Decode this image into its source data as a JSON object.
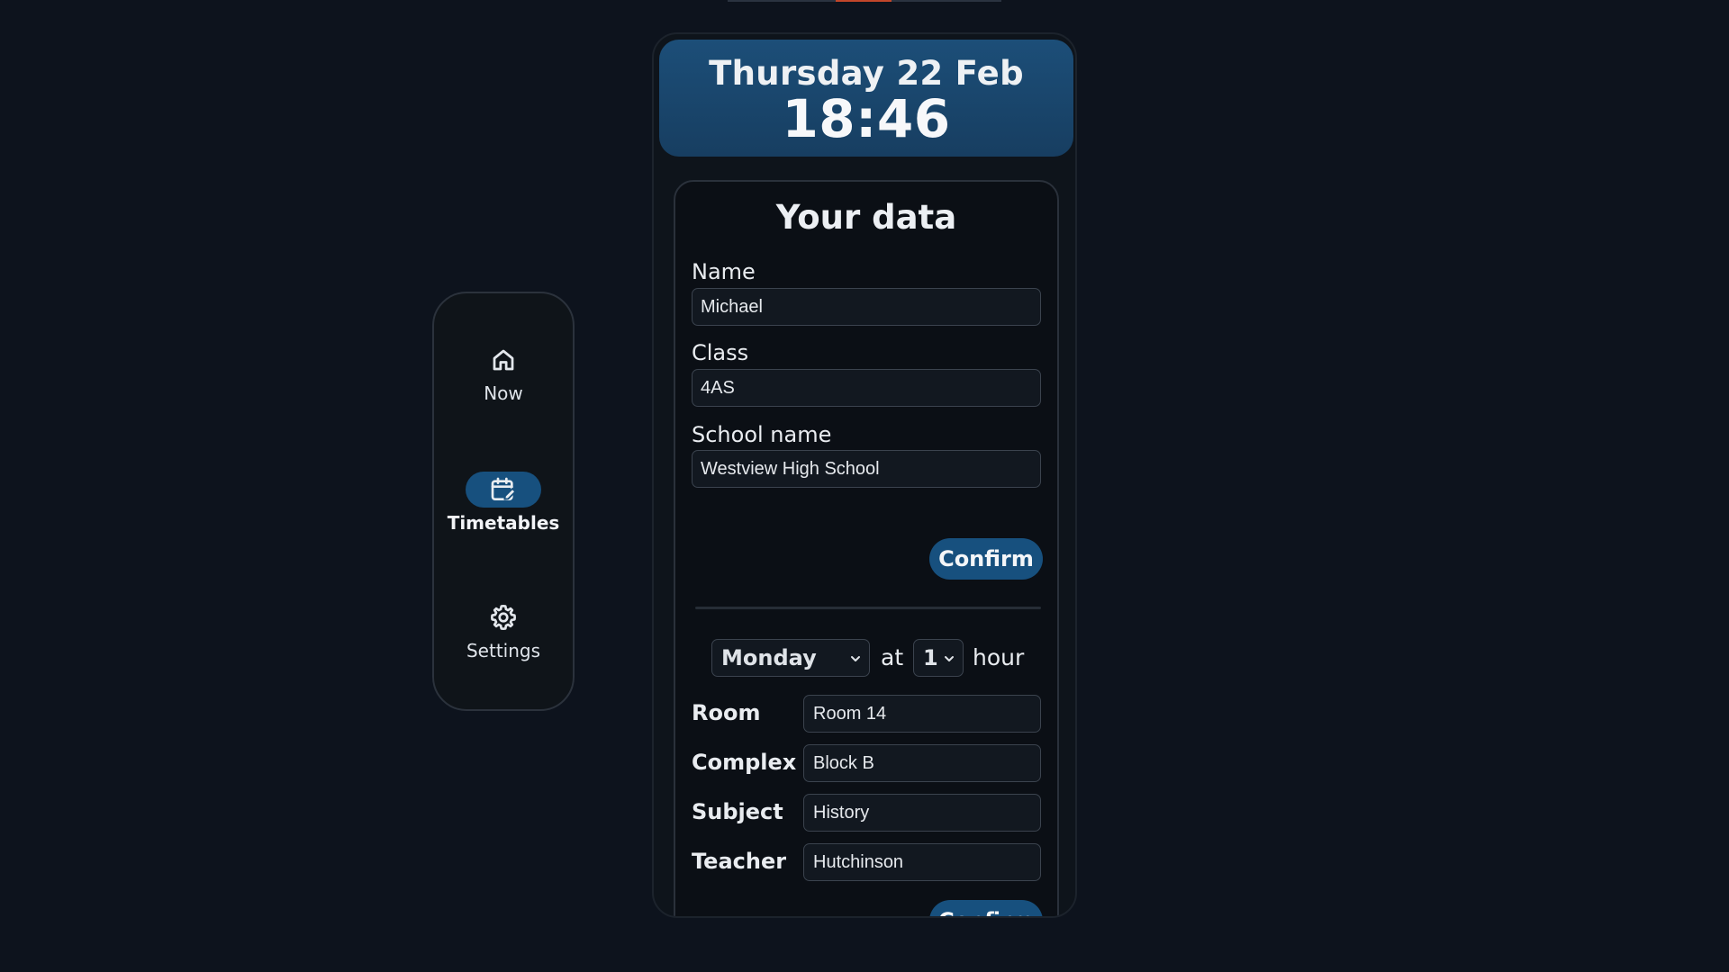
{
  "colors": {
    "background": "#0d131d",
    "accent": "#17507e",
    "header_gradient_top": "#1c4e78",
    "top_strip_accent": "#c2462a"
  },
  "nav": {
    "items": [
      {
        "label": "Now",
        "icon": "home-icon",
        "active": false
      },
      {
        "label": "Timetables",
        "icon": "calendar-edit-icon",
        "active": true
      },
      {
        "label": "Settings",
        "icon": "gear-icon",
        "active": false
      }
    ]
  },
  "header": {
    "date": "Thursday 22 Feb",
    "time": "18:46"
  },
  "your_data": {
    "title": "Your data",
    "name_label": "Name",
    "name_value": "Michael",
    "class_label": "Class",
    "class_value": "4AS",
    "school_label": "School name",
    "school_value": "Westview High School",
    "confirm_label": "Confirm"
  },
  "schedule": {
    "day_selected": "Monday",
    "at_text": "at",
    "hour_selected": "1",
    "hour_text": "hour",
    "room_label": "Room",
    "room_value": "Room 14",
    "complex_label": "Complex",
    "complex_value": "Block B",
    "subject_label": "Subject",
    "subject_value": "History",
    "teacher_label": "Teacher",
    "teacher_value": "Hutchinson",
    "confirm_label": "Confirm"
  }
}
